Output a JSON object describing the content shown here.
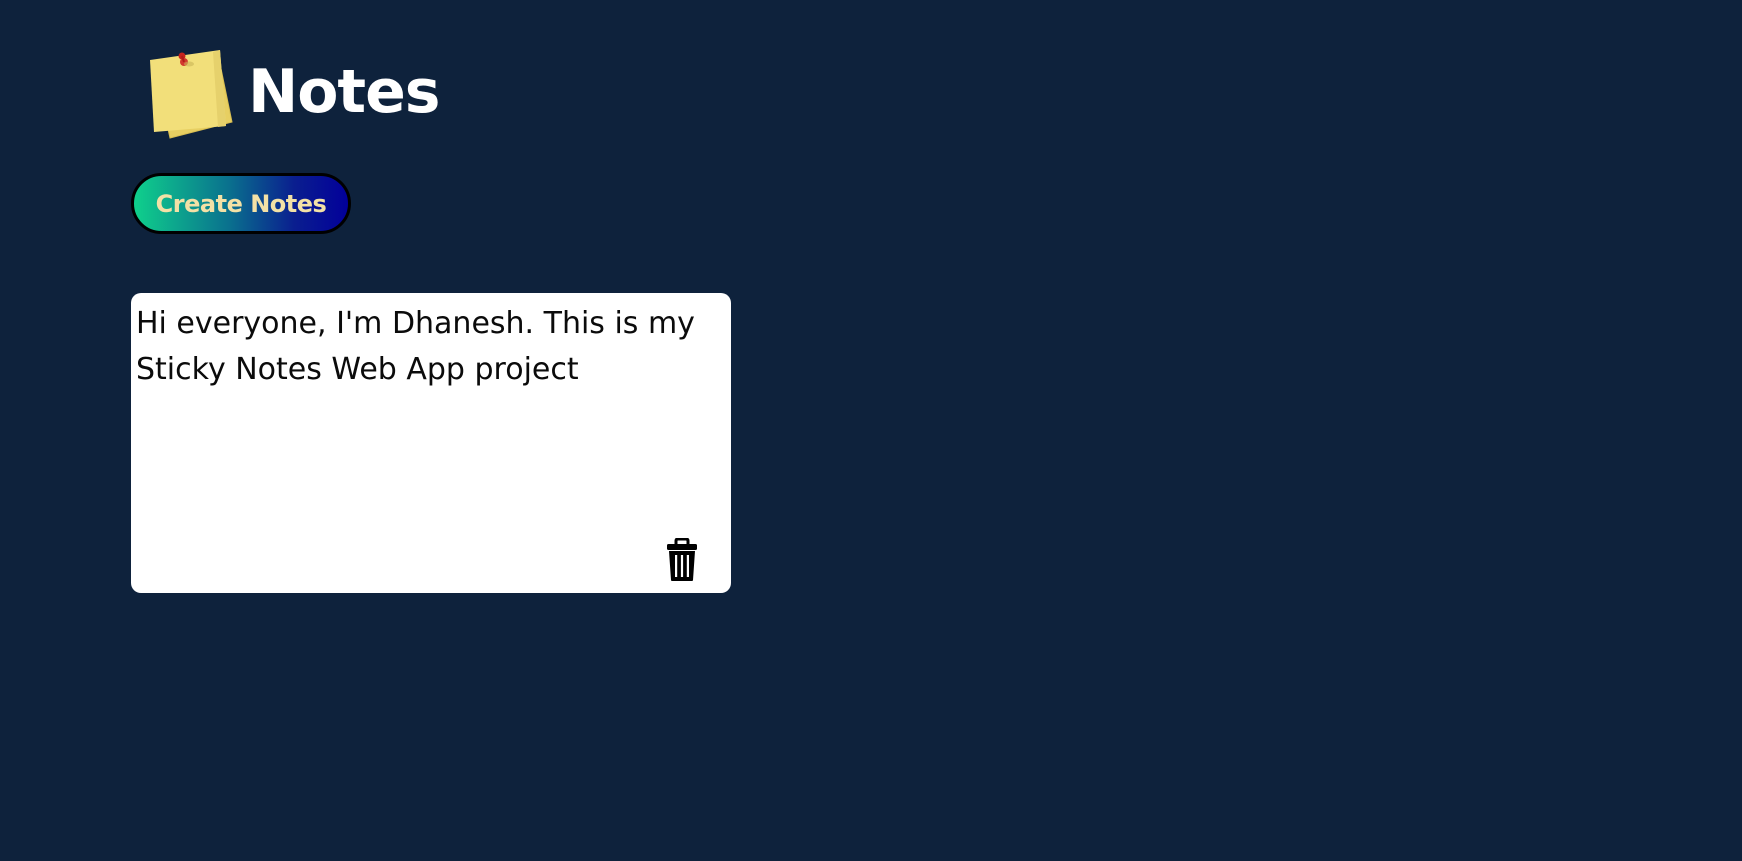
{
  "header": {
    "title": "Notes",
    "logo_icon": "sticky-notes-icon"
  },
  "actions": {
    "create_label": "Create Notes"
  },
  "notes": [
    {
      "text": "Hi everyone, I'm Dhanesh. This is my Sticky Notes Web App project",
      "delete_icon": "trash-icon"
    }
  ],
  "colors": {
    "background": "#0e223c",
    "note_background": "#ffffff",
    "button_gradient_start": "#0fd08c",
    "button_gradient_end": "#02009a",
    "button_text": "#f3e1a6",
    "title_text": "#ffffff",
    "sticky_note": "#f2df7a"
  }
}
